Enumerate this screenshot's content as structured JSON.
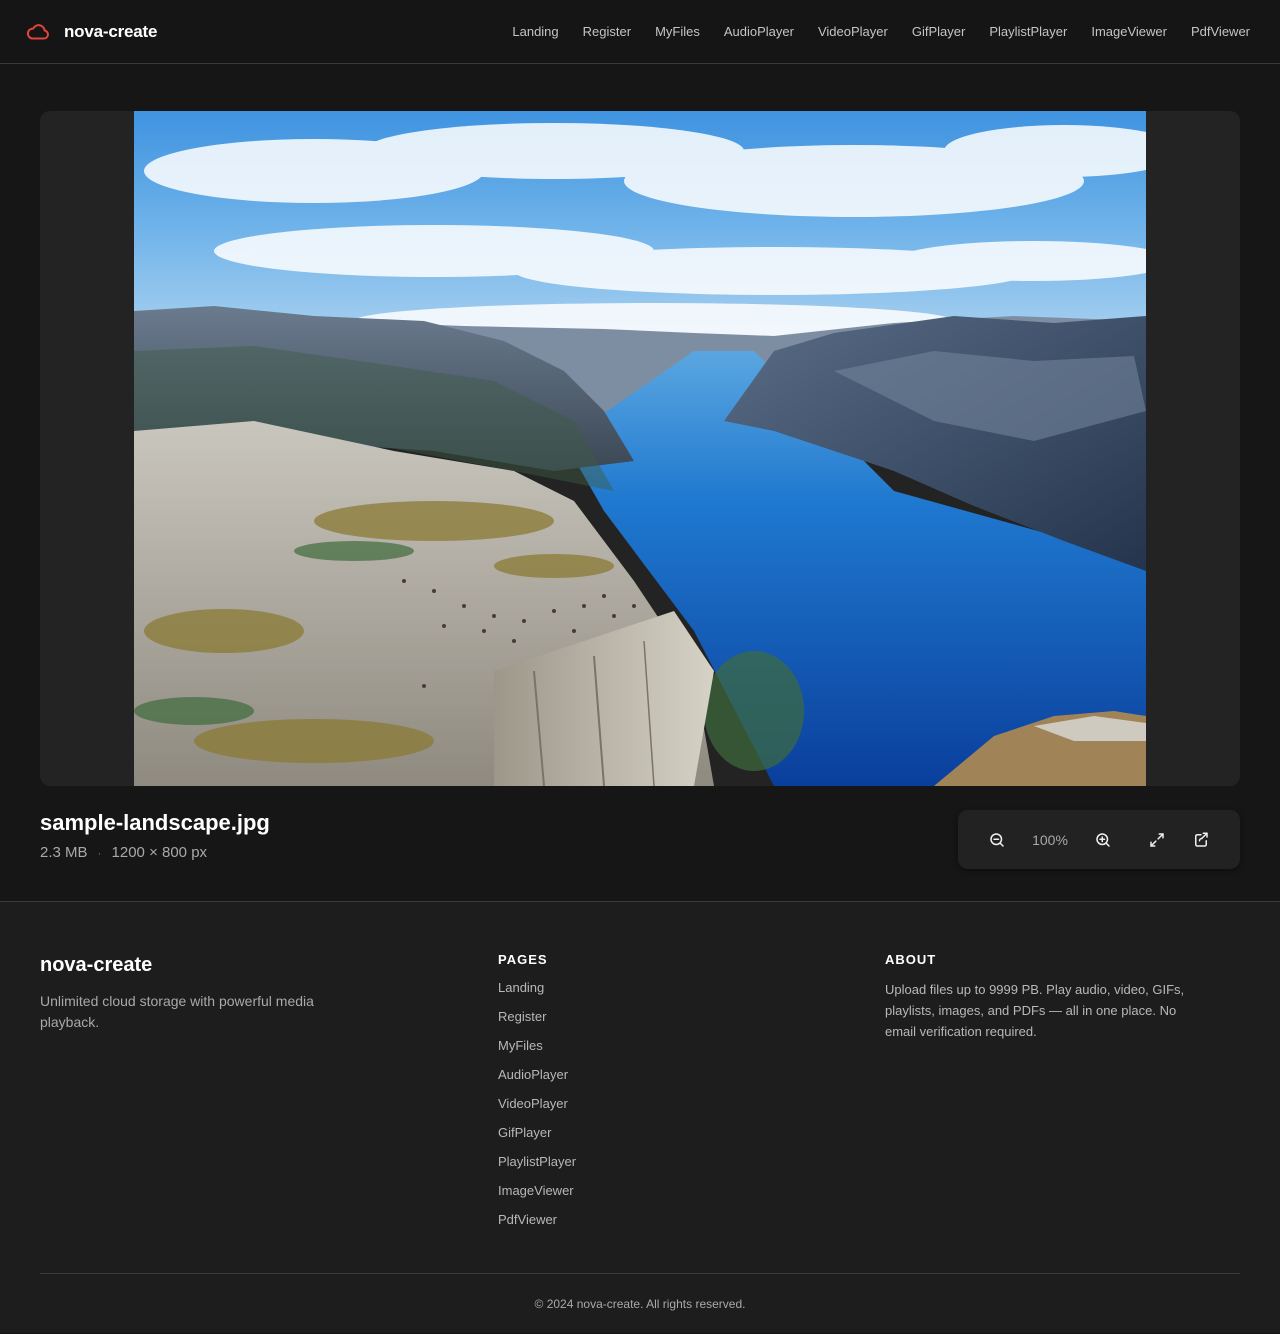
{
  "header": {
    "brand": "nova-create",
    "nav": [
      "Landing",
      "Register",
      "MyFiles",
      "AudioPlayer",
      "VideoPlayer",
      "GifPlayer",
      "PlaylistPlayer",
      "ImageViewer",
      "PdfViewer"
    ]
  },
  "viewer": {
    "file_name": "sample-landscape.jpg",
    "file_size": "2.3 MB",
    "separator": "·",
    "dimensions": "1200 × 800 px",
    "zoom_level": "100%",
    "controls": {
      "zoom_out": "zoom-out-icon",
      "zoom_in": "zoom-in-icon",
      "fullscreen": "expand-icon",
      "open": "share-icon"
    }
  },
  "footer": {
    "brand": "nova-create",
    "tagline": "Unlimited cloud storage with powerful media playback.",
    "pages_heading": "PAGES",
    "pages": [
      "Landing",
      "Register",
      "MyFiles",
      "AudioPlayer",
      "VideoPlayer",
      "GifPlayer",
      "PlaylistPlayer",
      "ImageViewer",
      "PdfViewer"
    ],
    "about_heading": "ABOUT",
    "about_text": "Upload files up to 9999 PB. Play audio, video, GIFs, playlists, images, and PDFs — all in one place. No email verification required.",
    "copyright": "© 2024 nova-create. All rights reserved."
  },
  "colors": {
    "accent": "#e0443a",
    "background": "#161616",
    "surface": "#232323"
  }
}
